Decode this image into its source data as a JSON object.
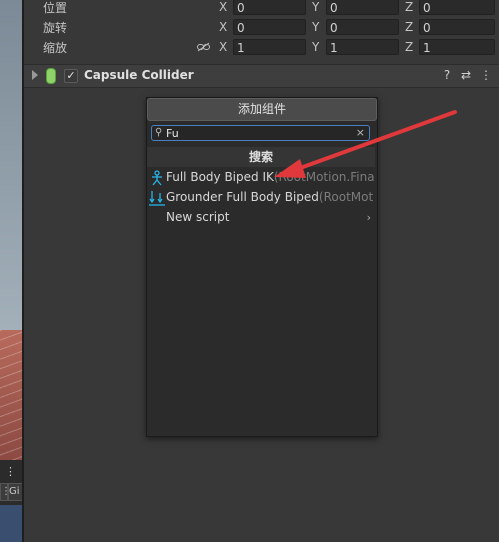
{
  "transform": {
    "position": {
      "label": "位置",
      "x": "0",
      "y": "0",
      "z": "0"
    },
    "rotation": {
      "label": "旋转",
      "x": "0",
      "y": "0",
      "z": "0"
    },
    "scale": {
      "label": "缩放",
      "x": "1",
      "y": "1",
      "z": "1"
    },
    "axes": {
      "x": "X",
      "y": "Y",
      "z": "Z"
    }
  },
  "component": {
    "title": "Capsule Collider",
    "enabled_check": "✓",
    "help_icon": "?",
    "settings_icon": "⇄",
    "more_icon": "⋮"
  },
  "popup": {
    "title": "添加组件",
    "search_value": "Fu",
    "search_glyph": "⚲",
    "clear_glyph": "×",
    "section_header": "搜索",
    "items": [
      {
        "name": "Full Body Biped IK",
        "namespace": "(RootMotion.Fina"
      },
      {
        "name": "Grounder Full Body Biped",
        "namespace": "(RootMot"
      },
      {
        "name": "New script",
        "namespace": "",
        "chevron": "›"
      }
    ]
  },
  "scene": {
    "dots": "⋮",
    "tab1": "⋮",
    "tab2": "Gi"
  },
  "colors": {
    "accent_arrow": "#e0383b",
    "icon_cyan": "#26b5e6",
    "capsule_green": "#8fd16b"
  }
}
